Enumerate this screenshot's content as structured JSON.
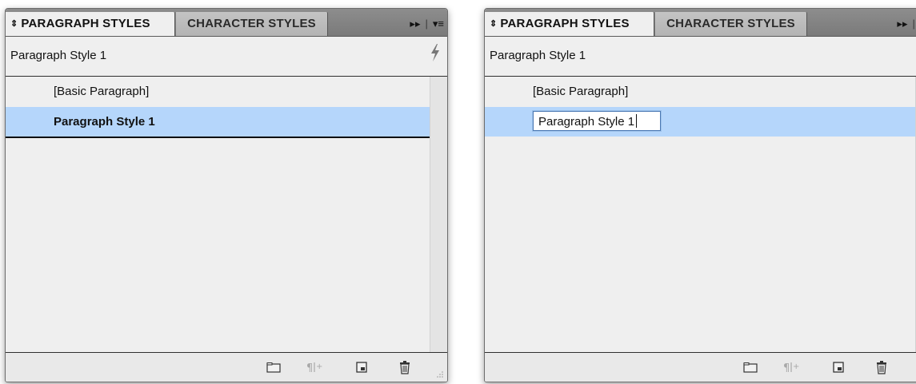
{
  "panels": [
    {
      "id": "left",
      "tabs": [
        {
          "label": "PARAGRAPH STYLES",
          "active": true
        },
        {
          "label": "CHARACTER STYLES",
          "active": false
        }
      ],
      "toolbar": {
        "expand_icon": "double-arrow-right-icon",
        "menu_icon": "panel-menu-icon"
      },
      "header": {
        "current_style": "Paragraph Style 1",
        "icon": "lightning-bolt-icon"
      },
      "list": [
        {
          "label": "[Basic Paragraph]",
          "selected": false
        },
        {
          "label": "Paragraph Style 1",
          "selected": true,
          "editing": false
        }
      ],
      "footer_icons": [
        "folder-icon",
        "clear-overrides-icon",
        "new-style-icon",
        "trash-icon"
      ]
    },
    {
      "id": "right",
      "tabs": [
        {
          "label": "PARAGRAPH STYLES",
          "active": true
        },
        {
          "label": "CHARACTER STYLES",
          "active": false
        }
      ],
      "toolbar": {
        "expand_icon": "double-arrow-right-icon",
        "menu_icon": "panel-menu-icon"
      },
      "header": {
        "current_style": "Paragraph Style 1",
        "icon": "lightning-bolt-icon"
      },
      "list": [
        {
          "label": "[Basic Paragraph]",
          "selected": false
        },
        {
          "label": "Paragraph Style 1",
          "selected": true,
          "editing": true
        }
      ],
      "footer_icons": [
        "folder-icon",
        "clear-overrides-icon",
        "new-style-icon",
        "trash-icon"
      ]
    }
  ],
  "colors": {
    "selection": "#b5d6fb",
    "panel_bg": "#efefef",
    "tabbar_bg": "#7f7f7f"
  }
}
